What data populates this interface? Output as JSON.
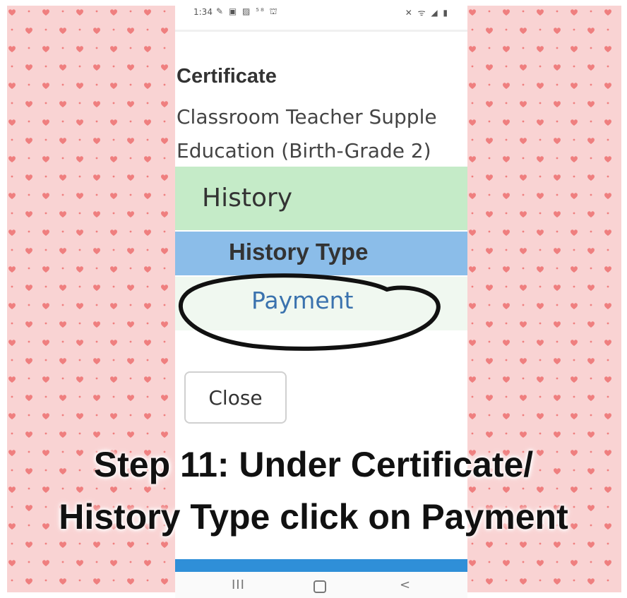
{
  "status_bar": {
    "time": "1:34",
    "notification_icons": "✎ ▣ ▨ ⁵⁸ ⛫",
    "system_icons": "✕ ᯤ ◢ ▮"
  },
  "certificate": {
    "label": "Certificate",
    "value_line1": "Classroom Teacher Supple",
    "value_line2": "Education (Birth-Grade 2)"
  },
  "history": {
    "header": "History",
    "type_header": "History Type",
    "items": [
      {
        "label": "Payment"
      }
    ]
  },
  "close_label": "Close",
  "nav": {
    "recents": "III",
    "back": "<"
  },
  "caption": {
    "line1": "Step 11: Under Certificate/",
    "line2": "History Type click on Payment"
  },
  "colors": {
    "pattern_bg": "#f9d3d3",
    "heart": "#ef7f7f",
    "history_header_bg": "#c5ebc8",
    "history_type_bg": "#8bbde9",
    "link": "#3a72ae",
    "bottom_bar": "#2f8fd8"
  }
}
